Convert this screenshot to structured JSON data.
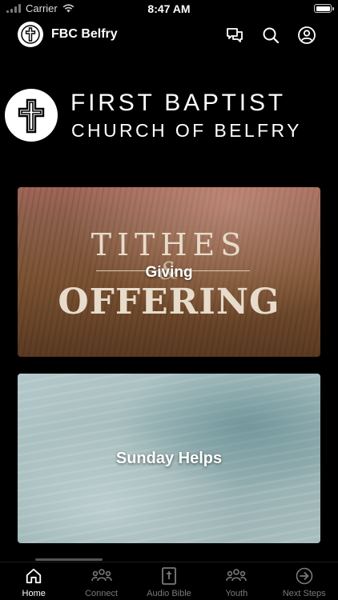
{
  "status_bar": {
    "carrier": "Carrier",
    "time": "8:47 AM"
  },
  "header": {
    "title": "FBC Belfry",
    "icons": [
      "cross-logo-icon",
      "chat-bubbles-icon",
      "search-icon",
      "profile-icon"
    ]
  },
  "banner": {
    "line1": "FIRST BAPTIST",
    "line2": "CHURCH OF BELFRY"
  },
  "cards": [
    {
      "label": "Giving",
      "art_top": "TITHES",
      "art_amp": "&",
      "art_bottom": "OFFERING"
    },
    {
      "label": "Sunday Helps"
    }
  ],
  "tabs": [
    {
      "label": "Home",
      "icon": "home-icon",
      "active": true
    },
    {
      "label": "Connect",
      "icon": "people-icon",
      "active": false
    },
    {
      "label": "Audio Bible",
      "icon": "bible-icon",
      "active": false
    },
    {
      "label": "Youth",
      "icon": "people-icon",
      "active": false
    },
    {
      "label": "Next Steps",
      "icon": "arrow-circle-icon",
      "active": false
    }
  ],
  "colors": {
    "background": "#000000",
    "active_tab": "#ffffff",
    "inactive_tab": "#7a7a7a"
  }
}
